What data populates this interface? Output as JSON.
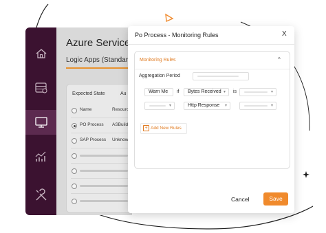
{
  "colors": {
    "sidebar": "#3b1230",
    "sidebar_active": "#5c2a4f",
    "accent": "#f08a2c",
    "accent_text": "#e07a1f"
  },
  "sidebar": {
    "items": [
      {
        "icon": "home-icon",
        "active": false
      },
      {
        "icon": "server-icon",
        "active": false
      },
      {
        "icon": "monitor-icon",
        "active": true
      },
      {
        "icon": "analytics-icon",
        "active": false
      },
      {
        "icon": "tools-icon",
        "active": false
      }
    ]
  },
  "app": {
    "title": "Azure Services",
    "subtitle": "Logic Apps (Standard)",
    "card": {
      "header_expected": "Expected State",
      "header_partial": "Au",
      "col_name": "Name",
      "col_resource": "Resourc",
      "rows": [
        {
          "name": "PO Process",
          "resource": "ASBuild",
          "checked": true
        },
        {
          "name": "SAP Process",
          "resource": "Unknow",
          "checked": false
        }
      ]
    }
  },
  "modal": {
    "title": "Po Process - Monitoring Rules",
    "close": "X",
    "section_title": "Monitoring Rules",
    "collapse_glyph": "^",
    "aggregation_label": "Aggregation Period",
    "rule1": {
      "severity": "Warn Me",
      "if": "if",
      "metric": "Bytes Received",
      "is": "is"
    },
    "rule2": {
      "metric": "Http Response"
    },
    "add_rules": "Add New Rules",
    "add_plus": "+",
    "cancel": "Cancel",
    "save": "Save"
  }
}
